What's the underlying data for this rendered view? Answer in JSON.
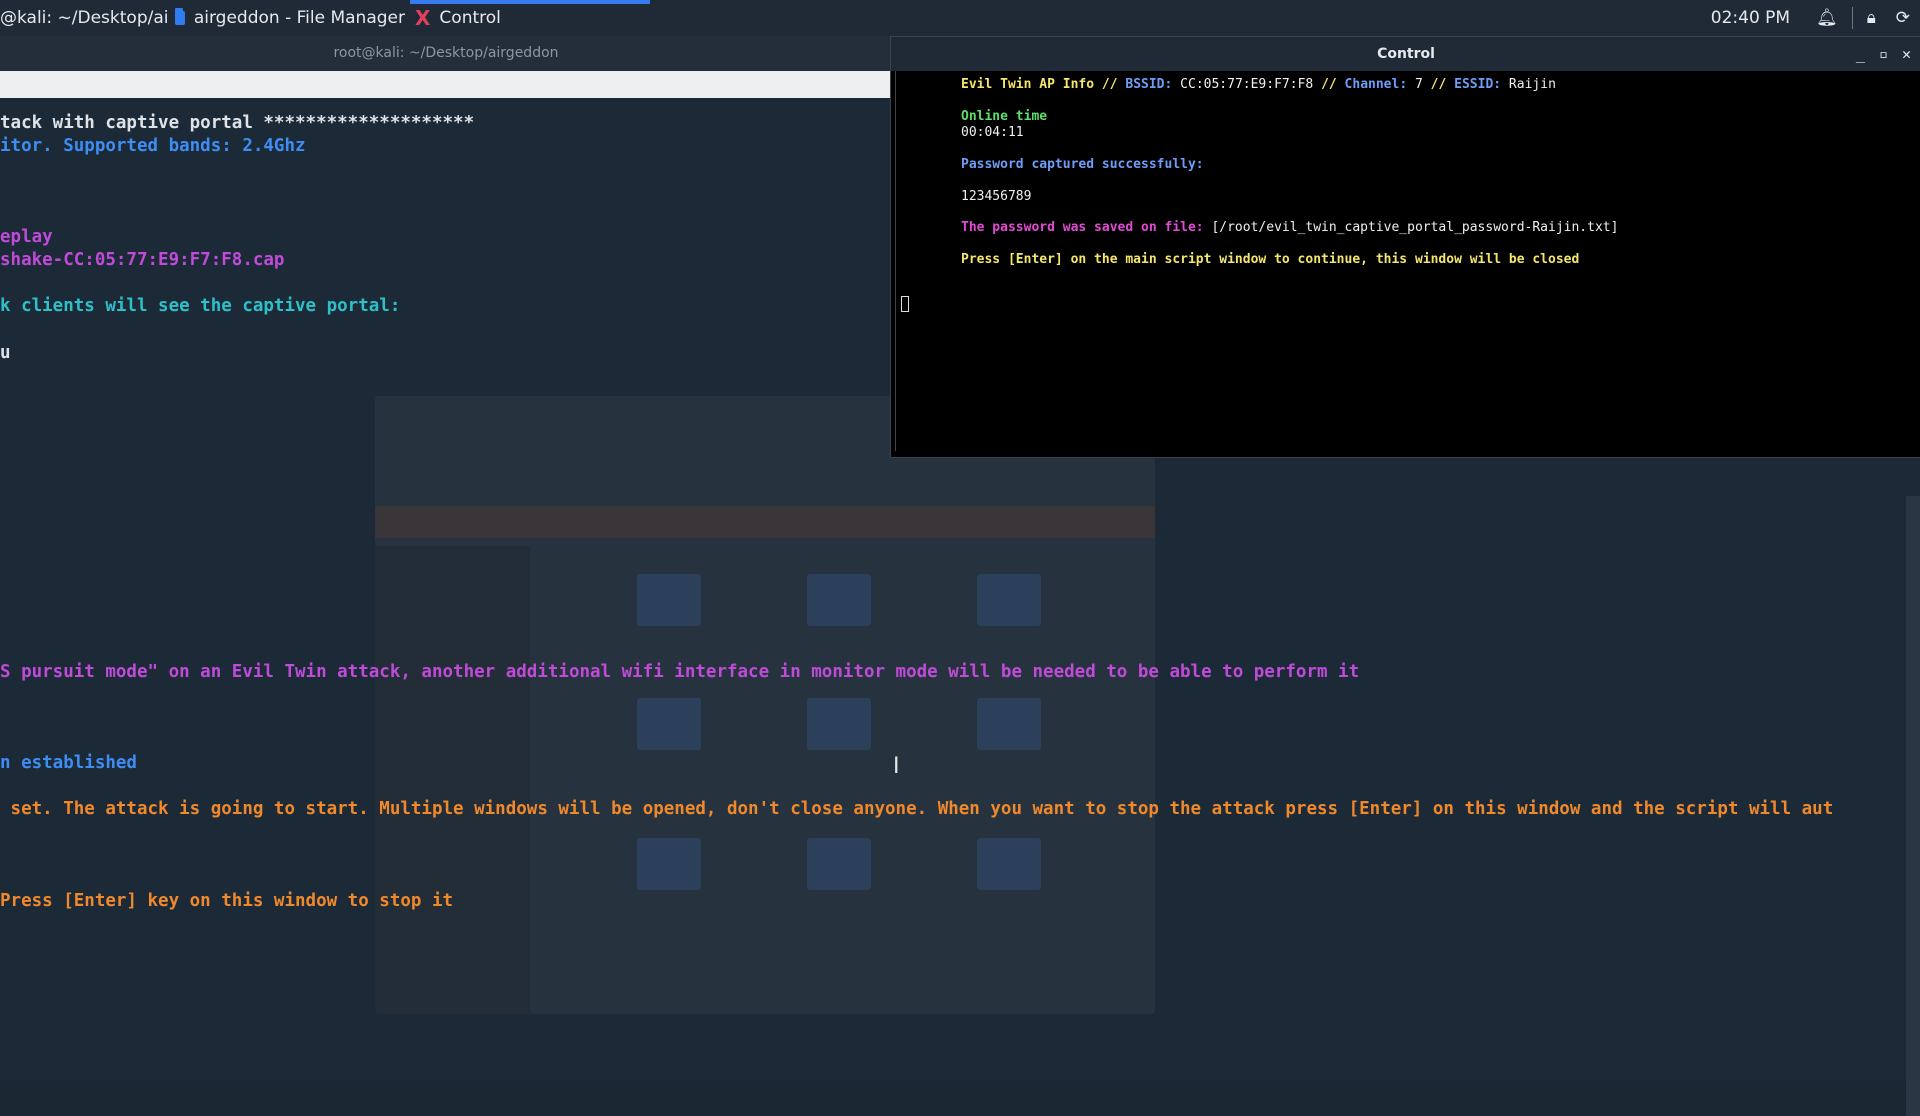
{
  "taskbar": {
    "tasks": [
      {
        "label": "@kali: ~/Desktop/ai..."
      },
      {
        "label": "airgeddon - File Manager",
        "icon": "folder-icon"
      },
      {
        "label": "Control",
        "icon": "x-terminal-icon"
      }
    ],
    "clock": "02:40 PM",
    "tray_icons": [
      "bell-icon",
      "lock-icon",
      "refresh-icon"
    ]
  },
  "bg_terminal": {
    "title": "root@kali: ~/Desktop/airgeddon",
    "lines": [
      "tack with captive portal ********************",
      "itor. Supported bands: 2.4Ghz",
      "eplay",
      "shake-CC:05:77:E9:F7:F8.cap",
      "k clients will see the captive portal:",
      "u",
      "S pursuit mode\" on an Evil Twin attack, another additional wifi interface in monitor mode will be needed to be able to perform it",
      "n established",
      " set. The attack is going to start. Multiple windows will be opened, don't close anyone. When you want to stop the attack press [Enter] on this window and the script will aut",
      "Press [Enter] key on this window to stop it"
    ]
  },
  "control": {
    "title": "Control",
    "info_prefix": "Evil Twin AP Info // ",
    "bssid_label": "BSSID:",
    "bssid_value": " CC:05:77:E9:F7:F8 ",
    "sep": "// ",
    "channel_label": "Channel:",
    "channel_value": " 7 ",
    "essid_label": "ESSID:",
    "essid_value": " Raijin",
    "online_label": "Online time",
    "online_value": "00:04:11",
    "captured_label": "Password captured successfully:",
    "password": "123456789",
    "saved_label": "The password was saved on file: ",
    "saved_path": "[/root/evil_twin_captive_portal_password-Raijin.txt]",
    "press_enter": "Press [Enter] on the main script window to continue, this window will be closed"
  },
  "colors": {
    "bg": "#1c2a38",
    "accent": "#367bf0",
    "orange": "#f0882c",
    "magenta": "#c04bd9"
  }
}
